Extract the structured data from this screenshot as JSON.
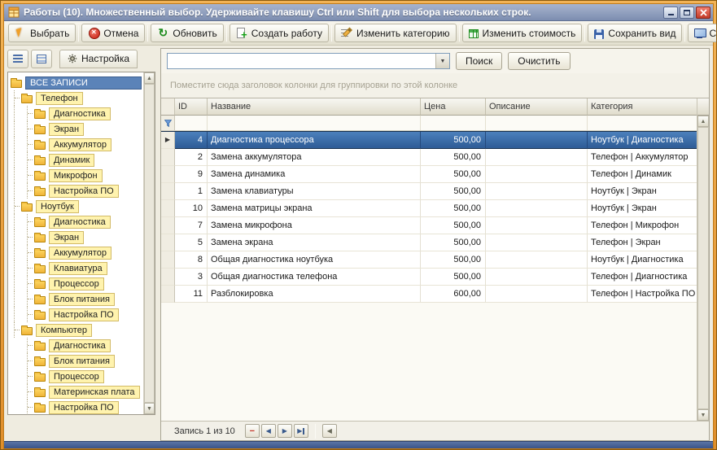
{
  "colors": {
    "frame_orange": "#E89B3C",
    "titlebar_blue": "#8496B8",
    "selection_blue": "#3E6EA8",
    "tree_chip_yellow": "#FFF3AE",
    "close_button_red": "#D8493C"
  },
  "window": {
    "title": "Работы (10). Множественный выбор. Удерживайте клавишу Ctrl или Shift для выбора нескольких строк."
  },
  "toolbar": {
    "buttons": [
      {
        "label": "Выбрать",
        "icon": "select-icon"
      },
      {
        "label": "Отмена",
        "icon": "cancel-icon"
      },
      {
        "label": "Обновить",
        "icon": "refresh-icon"
      },
      {
        "label": "Создать работу",
        "icon": "add-icon"
      },
      {
        "label": "Изменить категорию",
        "icon": "edit-category-icon"
      },
      {
        "label": "Изменить стоимость",
        "icon": "edit-price-icon"
      },
      {
        "label": "Сохранить вид",
        "icon": "save-icon"
      },
      {
        "label": "Скриншот",
        "icon": "screenshot-icon"
      }
    ]
  },
  "left_toolbar": {
    "settings_label": "Настройка"
  },
  "search": {
    "value": "",
    "search_label": "Поиск",
    "clear_label": "Очистить"
  },
  "tree": {
    "items": [
      {
        "label": "ВСЕ ЗАПИСИ",
        "level": 0,
        "type": "root",
        "selected": true
      },
      {
        "label": "Телефон",
        "level": 1,
        "type": "folder"
      },
      {
        "label": "Диагностика",
        "level": 2,
        "type": "item"
      },
      {
        "label": "Экран",
        "level": 2,
        "type": "item"
      },
      {
        "label": "Аккумулятор",
        "level": 2,
        "type": "item"
      },
      {
        "label": "Динамик",
        "level": 2,
        "type": "item"
      },
      {
        "label": "Микрофон",
        "level": 2,
        "type": "item"
      },
      {
        "label": "Настройка ПО",
        "level": 2,
        "type": "item"
      },
      {
        "label": "Ноутбук",
        "level": 1,
        "type": "folder"
      },
      {
        "label": "Диагностика",
        "level": 2,
        "type": "item"
      },
      {
        "label": "Экран",
        "level": 2,
        "type": "item"
      },
      {
        "label": "Аккумулятор",
        "level": 2,
        "type": "item"
      },
      {
        "label": "Клавиатура",
        "level": 2,
        "type": "item"
      },
      {
        "label": "Процессор",
        "level": 2,
        "type": "item"
      },
      {
        "label": "Блок питания",
        "level": 2,
        "type": "item"
      },
      {
        "label": "Настройка ПО",
        "level": 2,
        "type": "item"
      },
      {
        "label": "Компьютер",
        "level": 1,
        "type": "folder"
      },
      {
        "label": "Диагностика",
        "level": 2,
        "type": "item"
      },
      {
        "label": "Блок питания",
        "level": 2,
        "type": "item"
      },
      {
        "label": "Процессор",
        "level": 2,
        "type": "item"
      },
      {
        "label": "Материнская плата",
        "level": 2,
        "type": "item"
      },
      {
        "label": "Настройка ПО",
        "level": 2,
        "type": "item"
      }
    ]
  },
  "grid": {
    "group_hint": "Поместите сюда заголовок колонки для группировки по этой колонке",
    "columns": [
      "ID",
      "Название",
      "Цена",
      "Описание",
      "Категория"
    ],
    "rows": [
      {
        "id": "4",
        "name": "Диагностика процессора",
        "price": "500,00",
        "desc": "",
        "category": "Ноутбук | Диагностика",
        "selected": true
      },
      {
        "id": "2",
        "name": "Замена аккумулятора",
        "price": "500,00",
        "desc": "",
        "category": "Телефон | Аккумулятор"
      },
      {
        "id": "9",
        "name": "Замена динамика",
        "price": "500,00",
        "desc": "",
        "category": "Телефон | Динамик"
      },
      {
        "id": "1",
        "name": "Замена клавиатуры",
        "price": "500,00",
        "desc": "",
        "category": "Ноутбук | Экран"
      },
      {
        "id": "10",
        "name": "Замена матрицы экрана",
        "price": "500,00",
        "desc": "",
        "category": "Ноутбук | Экран"
      },
      {
        "id": "7",
        "name": "Замена микрофона",
        "price": "500,00",
        "desc": "",
        "category": "Телефон | Микрофон"
      },
      {
        "id": "5",
        "name": "Замена экрана",
        "price": "500,00",
        "desc": "",
        "category": "Телефон | Экран"
      },
      {
        "id": "8",
        "name": "Общая диагностика ноутбука",
        "price": "500,00",
        "desc": "",
        "category": "Ноутбук | Диагностика"
      },
      {
        "id": "3",
        "name": "Общая диагностика телефона",
        "price": "500,00",
        "desc": "",
        "category": "Телефон | Диагностика"
      },
      {
        "id": "11",
        "name": "Разблокировка",
        "price": "600,00",
        "desc": "",
        "category": "Телефон | Настройка ПО"
      }
    ]
  },
  "navigator": {
    "record_label": "Запись 1 из 10"
  }
}
